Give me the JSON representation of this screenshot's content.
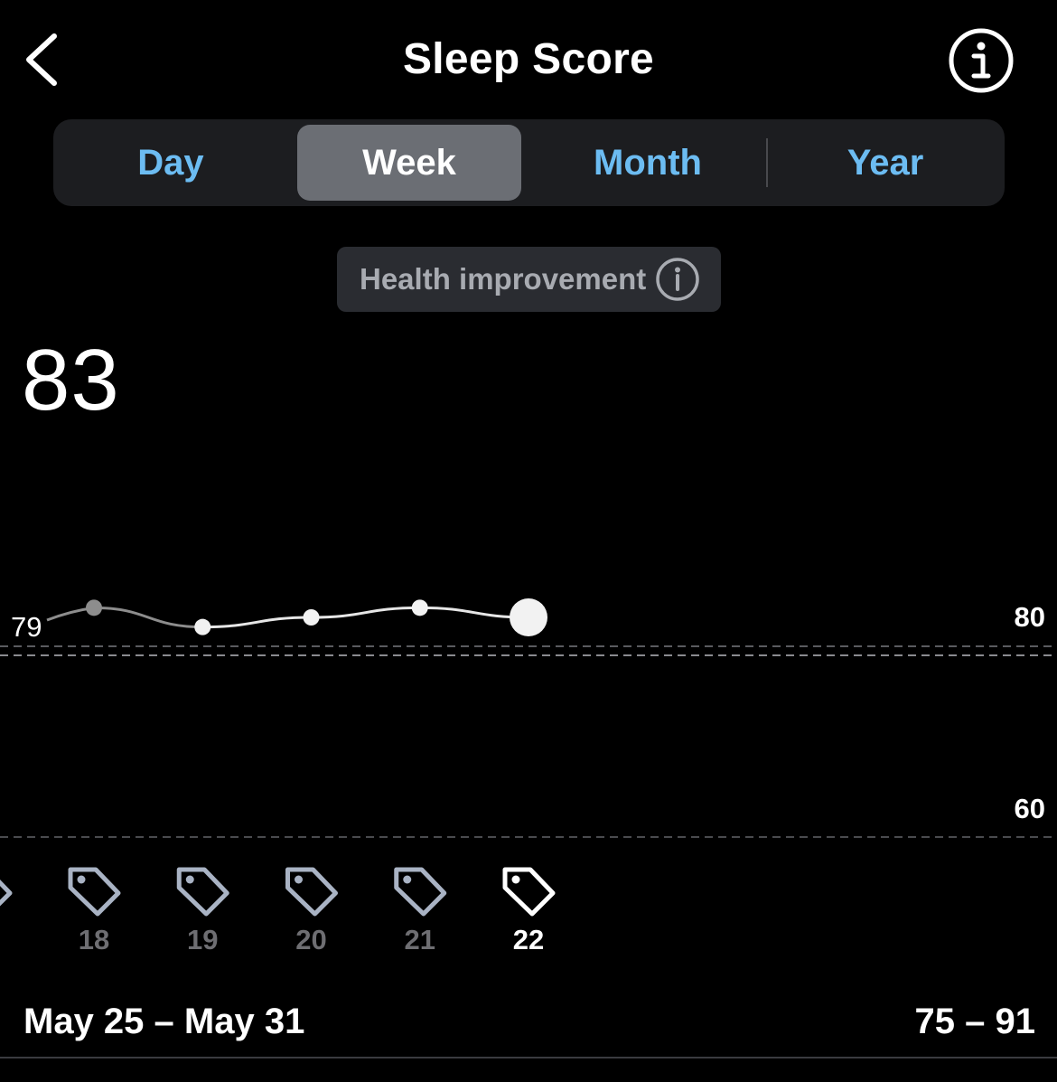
{
  "header": {
    "title": "Sleep Score",
    "back_icon": "chevron-left-icon",
    "info_icon": "info-circle-icon"
  },
  "tabs": [
    {
      "label": "Day",
      "active": false
    },
    {
      "label": "Week",
      "active": true
    },
    {
      "label": "Month",
      "active": false
    },
    {
      "label": "Year",
      "active": false
    }
  ],
  "health_pill": {
    "label": "Health improvement",
    "icon": "info-circle-icon"
  },
  "score": {
    "value": "83"
  },
  "chart_data": {
    "type": "line",
    "x": [
      "18",
      "19",
      "20",
      "21",
      "22"
    ],
    "values": [
      81,
      79,
      80,
      81,
      80
    ],
    "offscreen_left_value_label": "79",
    "highlighted_day": "22",
    "y_ticks": [
      "80",
      "60"
    ],
    "grid": "dashed",
    "tag_icons": "tag-icon"
  },
  "footer": {
    "date_range": "May 25 – May 31",
    "score_range": "75 – 91"
  },
  "colors": {
    "accent": "#6cbcf2",
    "active_tab": "#6b6e74",
    "segmented_bg": "#1c1d20",
    "pill_bg": "#2a2c31"
  }
}
